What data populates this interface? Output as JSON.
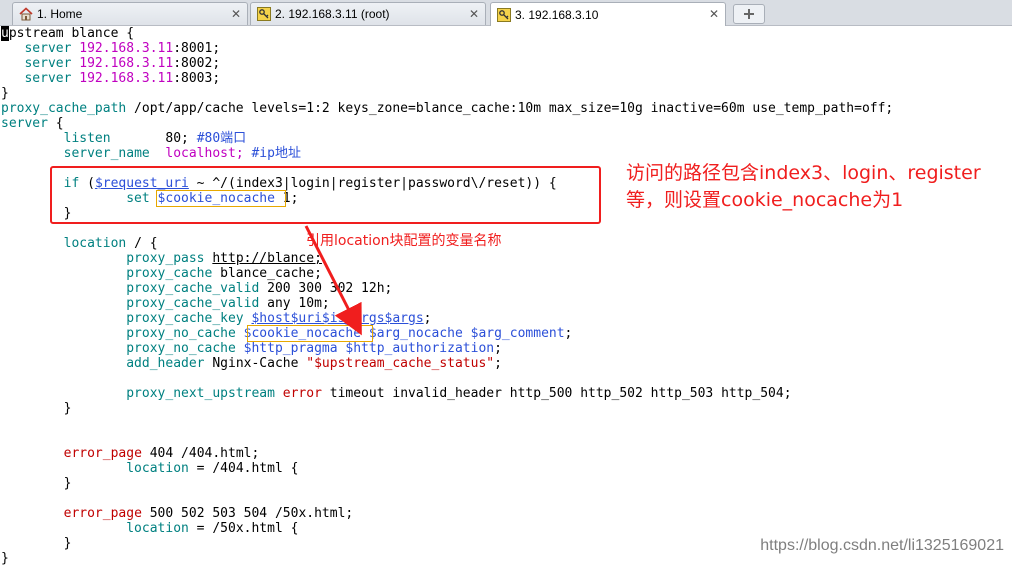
{
  "tabs": [
    {
      "label": "1. Home",
      "icon": "home-icon",
      "active": false
    },
    {
      "label": "2. 192.168.3.11 (root)",
      "icon": "key-icon",
      "active": false
    },
    {
      "label": "3. 192.168.3.10",
      "icon": "key-icon",
      "active": true
    }
  ],
  "new_tab_icon": "plus-icon",
  "colors": {
    "keyword": "#008080",
    "ip": "#c000c0",
    "comment": "#2b4fd8",
    "variable": "#2b4fd8",
    "annotation": "#f01e1e",
    "highlight_box": "#e7a800"
  },
  "code": {
    "l1": {
      "cursor": "u",
      "rest": "pstream blance {"
    },
    "l2": {
      "kw": "server",
      "ip": "192.168.3.11",
      "rest": ":8001;"
    },
    "l3": {
      "kw": "server",
      "ip": "192.168.3.11",
      "rest": ":8002;"
    },
    "l4": {
      "kw": "server",
      "ip": "192.168.3.11",
      "rest": ":8003;"
    },
    "l5": {
      "text": "}"
    },
    "l6": {
      "kw": "proxy_cache_path",
      "rest": " /opt/app/cache levels=1:2 keys_zone=blance_cache:10m max_size=10g inactive=60m use_temp_path=off;"
    },
    "l7": {
      "kw": "server",
      "rest": " {"
    },
    "l8": {
      "kw": "listen",
      "val": "80;",
      "cm": "#80端口"
    },
    "l9": {
      "kw": "server_name",
      "val": "localhost;",
      "cm": "#ip地址"
    },
    "l10": {
      "kw": "if",
      "a": " (",
      "var": "$request_uri",
      "b": " ~ ^/(index3|login|register|password\\/reset)) {"
    },
    "l11": {
      "kw": "set",
      "var": "$cookie_nocache",
      "b": " 1;"
    },
    "l12": {
      "text": "}"
    },
    "l13": {
      "kw": "location",
      "b": " / {"
    },
    "l14": {
      "kw": "proxy_pass",
      "url": "http://blance;"
    },
    "l15": {
      "kw": "proxy_cache",
      "b": " blance_cache;"
    },
    "l16": {
      "kw": "proxy_cache_valid",
      "b": " 200 300 302 12h;"
    },
    "l17": {
      "kw": "proxy_cache_valid",
      "b": " any 10m;"
    },
    "l18": {
      "kw": "proxy_cache_key",
      "var": "$host$uri$is_args$args",
      "b": ";"
    },
    "l19": {
      "kw": "proxy_no_cache",
      "var1": "$cookie_nocache",
      "var2": "$arg_nocache",
      "var3": "$arg_comment",
      "b": ";"
    },
    "l20": {
      "kw": "proxy_no_cache",
      "var1": "$http_pragma",
      "var2": "$http_authorization",
      "b": ";"
    },
    "l21": {
      "kw": "add_header",
      "a": " Nginx-Cache ",
      "str": "\"$upstream_cache_status\"",
      "b": ";"
    },
    "l22": {
      "kw": "proxy_next_upstream",
      "err": "error",
      "b": " timeout invalid_header http_500 http_502 http_503 http_504;"
    },
    "l23": {
      "text": "}"
    },
    "l24": {
      "err": "error_page",
      "b": " 404 /404.html;"
    },
    "l25": {
      "kw": "location",
      "b": " = /404.html {"
    },
    "l26": {
      "text": "}"
    },
    "l27": {
      "err": "error_page",
      "b": " 500 502 503 504 /50x.html;"
    },
    "l28": {
      "kw": "location",
      "b": " = /50x.html {"
    },
    "l29": {
      "text": "}"
    },
    "l30": {
      "text": "}"
    }
  },
  "annotations": {
    "explain": "访问的路径包含index3、login、register等，则设置cookie_nocache为1",
    "reference": "引用location块配置的变量名称"
  },
  "watermark": "https://blog.csdn.net/li1325169021"
}
